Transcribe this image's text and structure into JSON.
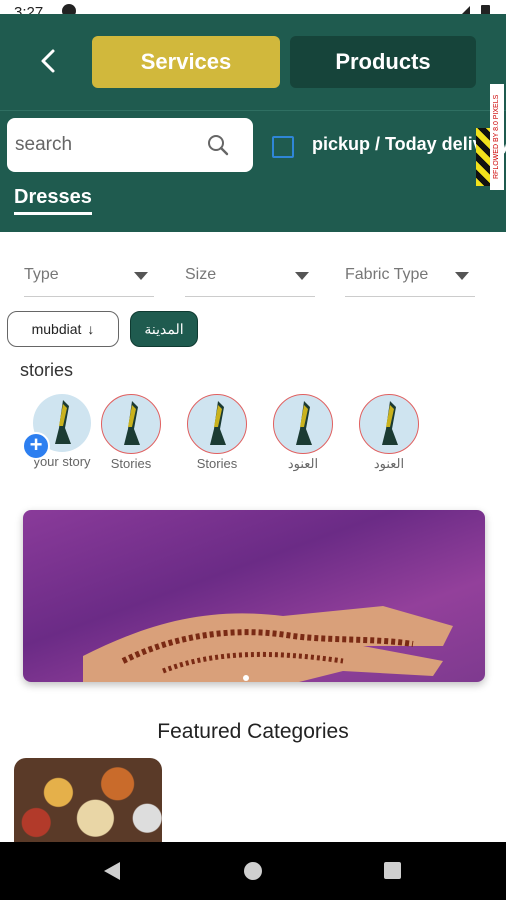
{
  "status": {
    "time": "3:27"
  },
  "header": {
    "tabs": {
      "services": "Services",
      "products": "Products"
    },
    "search": {
      "placeholder": "search"
    },
    "pickup_label": "pickup / Today delivery",
    "overflow_badge": "RFLOWED BY 8.0 PIXELS",
    "section_tab": "Dresses",
    "colors": {
      "header_bg": "#1f5b4f",
      "active_tab": "#d1b83c",
      "inactive_tab": "#16443a"
    }
  },
  "filters": [
    {
      "label": "Type"
    },
    {
      "label": "Size"
    },
    {
      "label": "Fabric Type"
    }
  ],
  "chips": {
    "sort": "mubdiat",
    "city": "المدينة"
  },
  "stories": {
    "title": "stories",
    "items": [
      {
        "label": "your story"
      },
      {
        "label": "Stories"
      },
      {
        "label": "Stories"
      },
      {
        "label": "العنود"
      },
      {
        "label": "العنود"
      }
    ]
  },
  "featured": {
    "title": "Featured Categories"
  }
}
